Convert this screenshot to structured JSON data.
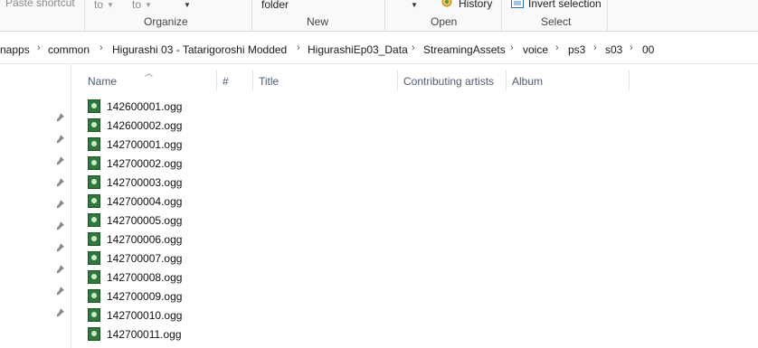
{
  "ribbon": {
    "paste_shortcut": "Paste shortcut",
    "move_to": "to",
    "copy_to": "to",
    "new_folder": "folder",
    "history": "History",
    "invert_selection": "Invert selection",
    "groups": {
      "organize": "Organize",
      "new": "New",
      "open": "Open",
      "select": "Select"
    }
  },
  "breadcrumb": [
    "napps",
    "common",
    "Higurashi 03 - Tatarigoroshi Modded",
    "HigurashiEp03_Data",
    "StreamingAssets",
    "voice",
    "ps3",
    "s03",
    "00"
  ],
  "columns": {
    "name": "Name",
    "number": "#",
    "title": "Title",
    "contributing_artists": "Contributing artists",
    "album": "Album"
  },
  "files": [
    "142600001.ogg",
    "142600002.ogg",
    "142700001.ogg",
    "142700002.ogg",
    "142700003.ogg",
    "142700004.ogg",
    "142700005.ogg",
    "142700006.ogg",
    "142700007.ogg",
    "142700008.ogg",
    "142700009.ogg",
    "142700010.ogg",
    "142700011.ogg"
  ],
  "icons": {
    "file": "ogg-file-icon",
    "pin": "pin-icon",
    "history": "history-icon",
    "invert_selection": "invert-selection-icon"
  }
}
